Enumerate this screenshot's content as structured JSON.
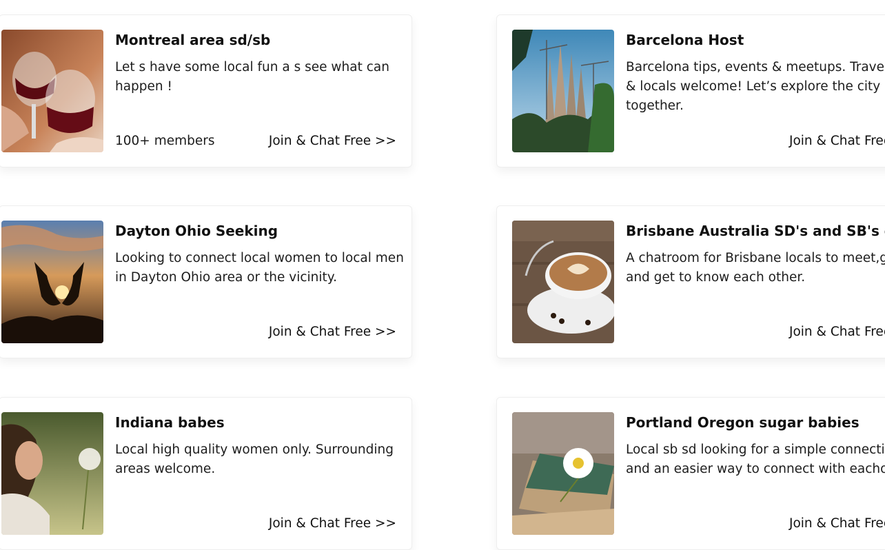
{
  "join_label": "Join & Chat Free >>",
  "cards": [
    {
      "title": "Montreal area sd/sb",
      "description": "Let s have some local fun a s see what can happen !",
      "members": "100+ members",
      "image": "red-wine-glasses"
    },
    {
      "title": "Barcelona Host",
      "description": "Barcelona tips, events & meetups. Travelers & locals welcome! Let’s explore the city together.",
      "members": "",
      "image": "sagrada-familia"
    },
    {
      "title": "Dayton Ohio Seeking",
      "description": "Looking to connect local women to local men in Dayton Ohio area or the vicinity.",
      "members": "",
      "image": "heart-hands-sunset"
    },
    {
      "title": "Brisbane Australia SD's and SB's only",
      "description": "A chatroom for Brisbane locals to meet,greet and get to know each other.",
      "members": "",
      "image": "latte-cup"
    },
    {
      "title": "Indiana babes",
      "description": "Local high quality women only. Surrounding areas welcome.",
      "members": "",
      "image": "woman-dandelion"
    },
    {
      "title": "Portland Oregon sugar babies",
      "description": "Local sb sd looking for a simple connection and an easier way to connect with eachother",
      "members": "",
      "image": "daisy-envelope"
    }
  ]
}
